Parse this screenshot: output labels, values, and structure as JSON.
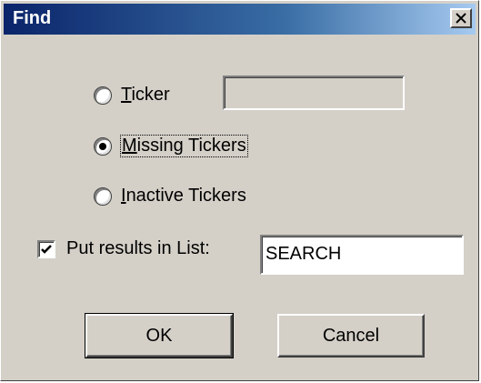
{
  "window": {
    "title": "Find",
    "close_glyph": "✕"
  },
  "options": {
    "ticker": {
      "mnemonic": "T",
      "rest": "icker",
      "value": ""
    },
    "missing": {
      "mnemonic": "M",
      "rest": "issing Tickers",
      "selected": true
    },
    "inactive": {
      "mnemonic": "I",
      "rest": "nactive Tickers"
    }
  },
  "results": {
    "checked": true,
    "label": "Put results in List:",
    "list_value": "SEARCH"
  },
  "buttons": {
    "ok_label": "OK",
    "cancel_label": "Cancel"
  }
}
